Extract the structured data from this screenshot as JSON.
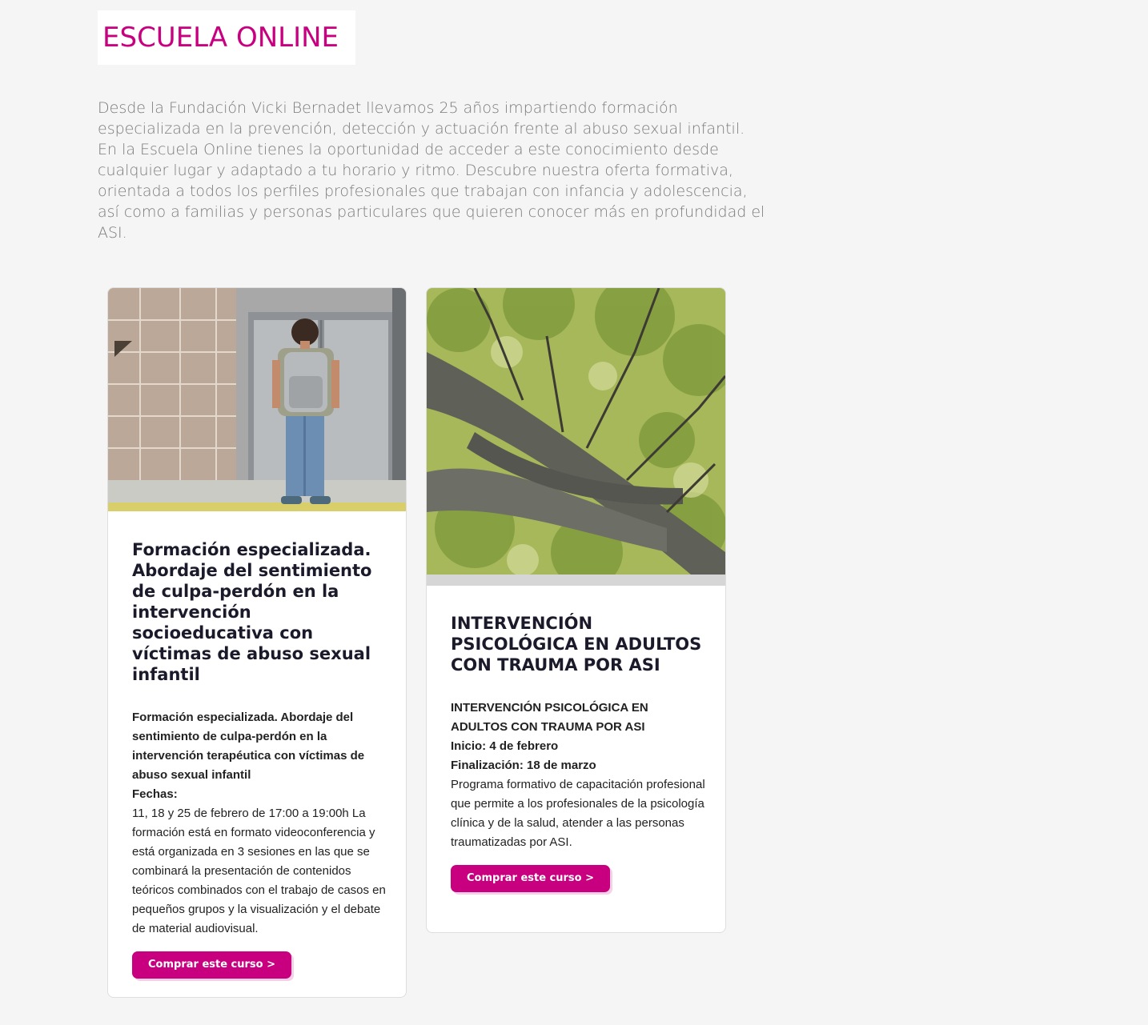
{
  "page": {
    "title": "ESCUELA ONLINE",
    "intro": "Desde la Fundación Vicki Bernadet llevamos 25 años impartiendo formación especializada en la prevención, detección y actuación frente al abuso sexual infantil. En la Escuela Online tienes la oportunidad de acceder a este conocimiento desde cualquier lugar y adaptado a tu horario y ritmo. Descubre nuestra oferta formativa, orientada a todos los perfiles profesionales que trabajan con infancia y adolescencia, así como a familias y personas particulares que quieren conocer más en profundidad el ASI."
  },
  "colors": {
    "accent": "#c8007f",
    "background": "#f5f5f5",
    "intro_text": "#7a7a7a"
  },
  "courses": [
    {
      "image": "boy-with-backpack-photo",
      "title": "Formación especializada. Abordaje del sentimiento de culpa-perdón en la intervención socioeducativa con víctimas de abuso sexual infantil",
      "desc_bold": "Formación especializada. Abordaje del sentimiento de culpa-perdón en la intervención terapéutica con víctimas de abuso sexual infantil",
      "dates_label": "Fechas:",
      "desc_text": "11, 18 y 25 de febrero de 17:00 a 19:00h La formación está en formato videoconferencia y está organizada en 3 sesiones en las que se combinará la presentación de contenidos teóricos combinados con el trabajo de casos en pequeños grupos y la visualización y el debate de material audiovisual.",
      "button": "Comprar este curso >"
    },
    {
      "image": "tree-canopy-photo",
      "title": "INTERVENCIÓN PSICOLÓGICA EN ADULTOS CON TRAUMA POR ASI",
      "desc_bold": "INTERVENCIÓN PSICOLÓGICA EN ADULTOS CON TRAUMA POR ASI",
      "start": "Inicio: 4 de febrero",
      "end": "Finalización: 18 de marzo",
      "desc_text": "Programa formativo de capacitación profesional que permite a los profesionales de la psicología clínica y de la salud, atender a las personas traumatizadas por ASI.",
      "button": "Comprar este curso >"
    }
  ]
}
